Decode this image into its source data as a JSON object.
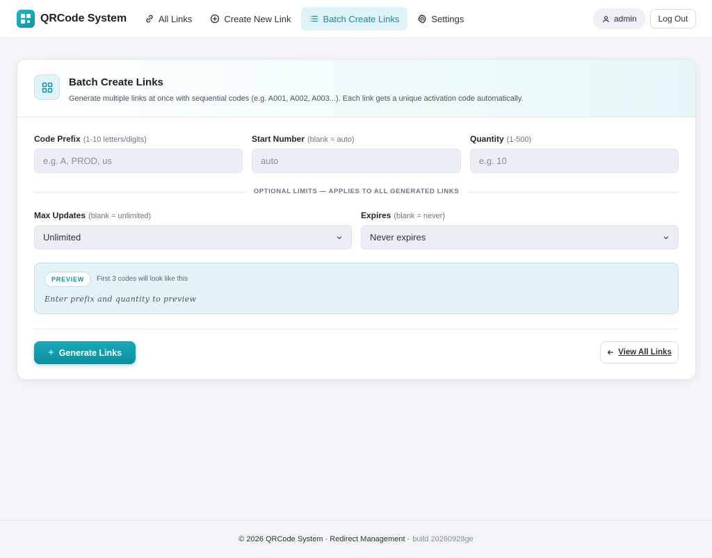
{
  "app": {
    "name": "QRCode System"
  },
  "nav": {
    "items": [
      {
        "label": "All Links",
        "icon": "link-icon"
      },
      {
        "label": "Create New Link",
        "icon": "plus-circle-icon"
      },
      {
        "label": "Batch Create Links",
        "icon": "list-icon",
        "active": true
      },
      {
        "label": "Settings",
        "icon": "gear-icon"
      }
    ]
  },
  "user": {
    "name": "admin",
    "logout_label": "Log Out"
  },
  "card": {
    "title": "Batch Create Links",
    "description": "Generate multiple links at once with sequential codes (e.g. A001, A002, A003...). Each link gets a unique activation code automatically."
  },
  "form": {
    "prefix": {
      "label": "Code Prefix",
      "hint": "(1-10 letters/digits)",
      "placeholder": "e.g. A, PROD, us",
      "value": ""
    },
    "start": {
      "label": "Start Number",
      "hint": "(blank = auto)",
      "placeholder": "auto",
      "value": ""
    },
    "quantity": {
      "label": "Quantity",
      "hint": "(1-500)",
      "placeholder": "e.g. 10",
      "value": ""
    },
    "divider_text": "OPTIONAL LIMITS — APPLIES TO ALL GENERATED LINKS",
    "max_updates": {
      "label": "Max Updates",
      "hint": "(blank = unlimited)",
      "selected": "Unlimited"
    },
    "expires": {
      "label": "Expires",
      "hint": "(blank = never)",
      "selected": "Never expires"
    }
  },
  "preview": {
    "badge": "PREVIEW",
    "note": "First 3 codes will look like this",
    "empty_text": "Enter prefix and quantity to preview"
  },
  "actions": {
    "generate_label": "Generate Links",
    "view_all_label": "View All Links"
  },
  "footer": {
    "text": "© 2026 QRCode System · Redirect Management ·",
    "build": "build 20260928ge"
  },
  "colors": {
    "accent": "#0e8fa2",
    "accent_light": "#dff3f6",
    "page_bg": "#f3f4f8"
  }
}
